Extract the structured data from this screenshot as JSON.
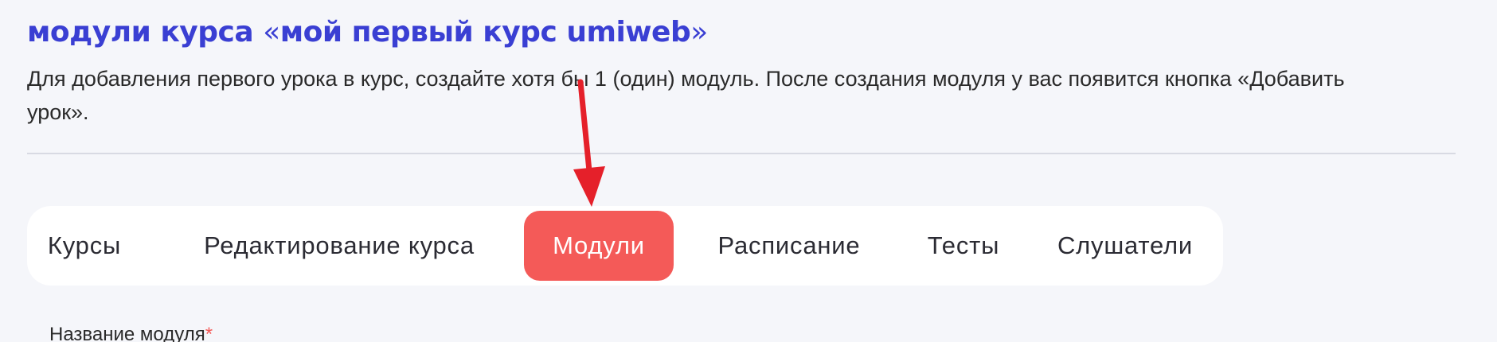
{
  "header": {
    "title_prefix": "модули курса ",
    "quote_open": "«",
    "course_name": "мой первый курс umiweb",
    "quote_close": "»",
    "description": "Для добавления первого урока в курс, создайте хотя бы 1 (один) модуль. После создания модуля у вас появится кнопка «Добавить урок»."
  },
  "tabs": [
    {
      "label": "Курсы",
      "active": false
    },
    {
      "label": "Редактирование курса",
      "active": false
    },
    {
      "label": "Модули",
      "active": true
    },
    {
      "label": "Расписание",
      "active": false
    },
    {
      "label": "Тесты",
      "active": false
    },
    {
      "label": "Слушатели",
      "active": false
    }
  ],
  "form": {
    "module_name_label": "Название модуля",
    "required_mark": "*"
  },
  "colors": {
    "title": "#3a3fd3",
    "active_tab": "#f45a58",
    "arrow": "#e5202a"
  },
  "annotation": {
    "icon": "arrow-down-icon"
  }
}
